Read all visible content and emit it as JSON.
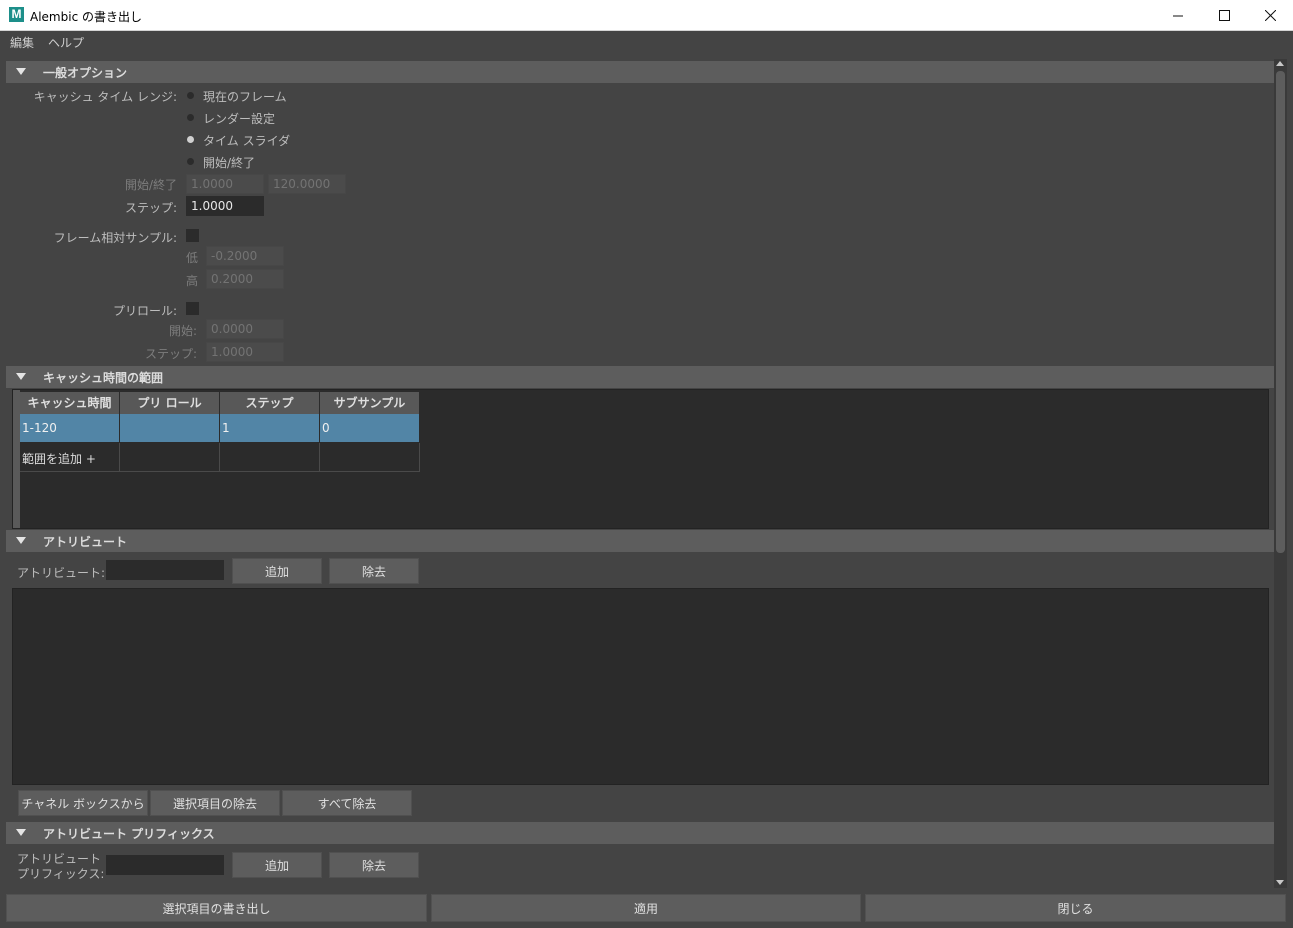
{
  "window": {
    "title": "Alembic の書き出し",
    "app_icon_letter": "M"
  },
  "menu": {
    "edit": "編集",
    "help": "ヘルプ"
  },
  "general": {
    "header": "一般オプション",
    "cache_range_label": "キャッシュ タイム レンジ:",
    "radios": [
      {
        "label": "現在のフレーム",
        "selected": false
      },
      {
        "label": "レンダー設定",
        "selected": false
      },
      {
        "label": "タイム スライダ",
        "selected": true
      },
      {
        "label": "開始/終了",
        "selected": false
      }
    ],
    "start_end_label": "開始/終了",
    "start_value": "1.0000",
    "end_value": "120.0000",
    "step_label": "ステップ:",
    "step_value": "1.0000",
    "frame_relative_label": "フレーム相対サンプル:",
    "frame_relative_checked": false,
    "low_label": "低",
    "low_value": "-0.2000",
    "high_label": "高",
    "high_value": "0.2000",
    "preroll_label": "プリロール:",
    "preroll_checked": false,
    "preroll_start_label": "開始:",
    "preroll_start_value": "0.0000",
    "preroll_step_label": "ステップ:",
    "preroll_step_value": "1.0000"
  },
  "cache_ranges": {
    "header": "キャッシュ時間の範囲",
    "columns": [
      "キャッシュ時間",
      "プリ ロール",
      "ステップ",
      "サブサンプル"
    ],
    "rows": [
      {
        "cells": [
          "1-120",
          "",
          "1",
          "0"
        ]
      },
      {
        "cells": [
          "範囲を追加 +",
          "",
          "",
          ""
        ]
      }
    ]
  },
  "attributes": {
    "header": "アトリビュート",
    "label": "アトリビュート:",
    "field_value": "",
    "add": "追加",
    "remove": "除去",
    "from_channel_box": "チャネル ボックスから",
    "remove_selected": "選択項目の除去",
    "remove_all": "すべて除去"
  },
  "attr_prefix": {
    "header": "アトリビュート プリフィックス",
    "label_line1": "アトリビュート",
    "label_line2": "プリフィックス:",
    "field_value": "",
    "add": "追加",
    "remove": "除去"
  },
  "footer": {
    "export_selection": "選択項目の書き出し",
    "apply": "適用",
    "close": "閉じる"
  },
  "colors": {
    "background": "#444444",
    "section_header": "#5d5d5d",
    "selection": "#5285a6",
    "field_dark": "#2b2b2b"
  }
}
